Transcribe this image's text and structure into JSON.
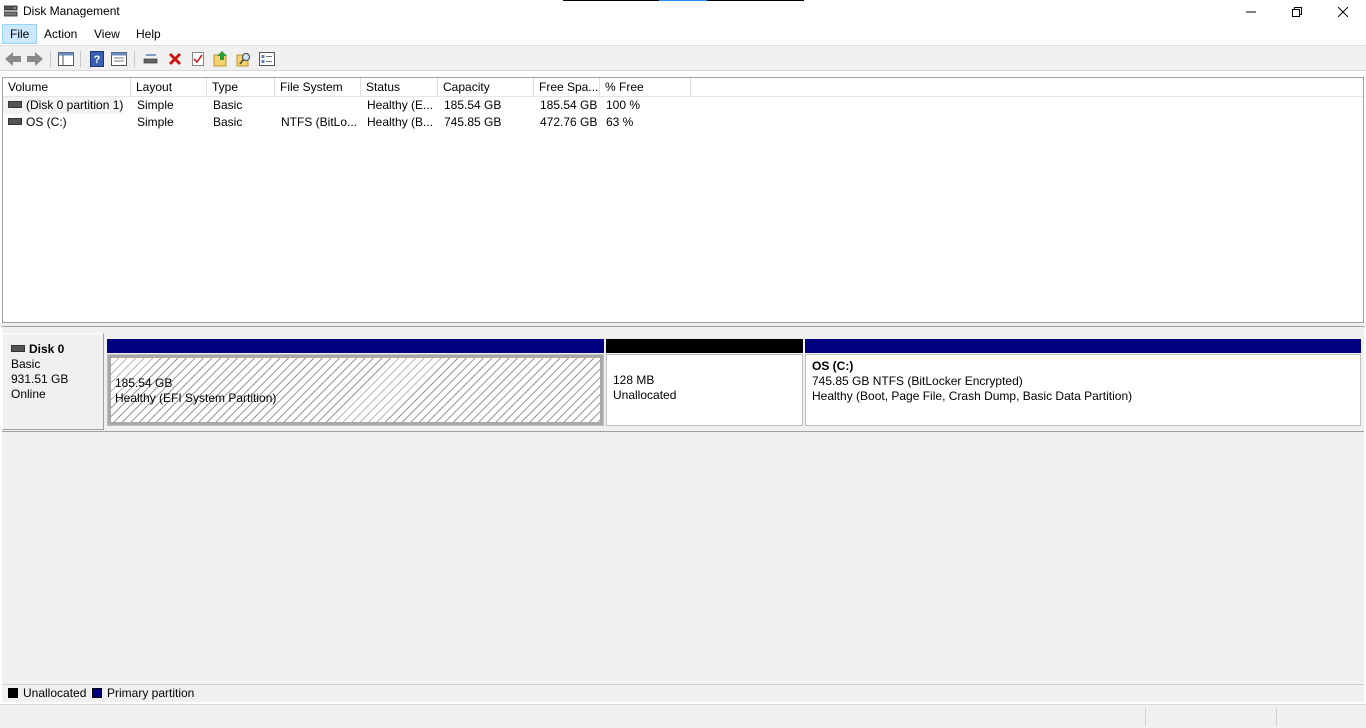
{
  "window": {
    "title": "Disk Management",
    "icon": "disk-management-icon",
    "minimize_icon": "minimize-icon",
    "restore_icon": "restore-icon",
    "close_icon": "close-icon"
  },
  "menu": [
    {
      "label": "File",
      "active": true
    },
    {
      "label": "Action"
    },
    {
      "label": "View"
    },
    {
      "label": "Help"
    }
  ],
  "toolbar": [
    "back-arrow-icon",
    "forward-arrow-icon",
    "console-tree-icon",
    "help-icon",
    "properties-icon",
    "connect-disk-icon",
    "delete-icon",
    "checkmark-icon",
    "export-icon",
    "search-icon",
    "settings-list-icon"
  ],
  "volume_list": {
    "columns": [
      "Volume",
      "Layout",
      "Type",
      "File System",
      "Status",
      "Capacity",
      "Free Spa...",
      "% Free"
    ],
    "rows": [
      {
        "volume": "(Disk 0 partition 1)",
        "layout": "Simple",
        "type": "Basic",
        "file_system": "",
        "status": "Healthy (E...",
        "capacity": "185.54 GB",
        "free_space": "185.54 GB",
        "pct_free": "100 %"
      },
      {
        "volume": "OS (C:)",
        "layout": "Simple",
        "type": "Basic",
        "file_system": "NTFS (BitLo...",
        "status": "Healthy (B...",
        "capacity": "745.85 GB",
        "free_space": "472.76 GB",
        "pct_free": "63 %"
      }
    ]
  },
  "disk": {
    "name": "Disk 0",
    "type": "Basic",
    "size": "931.51 GB",
    "state": "Online",
    "partitions": [
      {
        "title": "",
        "line1": "185.54 GB",
        "line2": "Healthy (EFI System Partition)",
        "kind": "primary",
        "bar_color": "#000080"
      },
      {
        "title": "",
        "line1": "128 MB",
        "line2": "Unallocated",
        "kind": "unallocated",
        "bar_color": "#000000"
      },
      {
        "title": "OS  (C:)",
        "line1": "745.85 GB NTFS (BitLocker Encrypted)",
        "line2": "Healthy (Boot, Page File, Crash Dump, Basic Data Partition)",
        "kind": "primary",
        "bar_color": "#000080"
      }
    ]
  },
  "legend": [
    {
      "label": "Unallocated",
      "color": "#000000"
    },
    {
      "label": "Primary partition",
      "color": "#000080"
    }
  ]
}
